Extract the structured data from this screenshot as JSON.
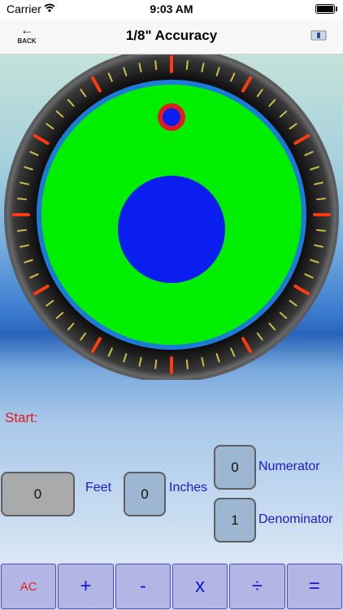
{
  "status_bar": {
    "carrier": "Carrier",
    "time": "9:03 AM"
  },
  "nav": {
    "back_label": "BACK",
    "back_arrow": "←",
    "title": "1/8\" Accuracy"
  },
  "start": {
    "label": "Start:"
  },
  "fields": {
    "feet": {
      "value": "0",
      "unit": "Feet"
    },
    "inches": {
      "value": "0",
      "unit": "Inches"
    },
    "numerator": {
      "value": "0",
      "unit": "Numerator"
    },
    "denominator": {
      "value": "1",
      "unit": "Denominator"
    }
  },
  "keypad": {
    "ac": "AC",
    "plus": "+",
    "minus": "-",
    "multiply": "x",
    "divide": "÷",
    "equals": "="
  },
  "colors": {
    "bezel": "#101010",
    "ring": "#1d7bd8",
    "face": "#00ee00",
    "bubble": "#0b1ef0",
    "indicator_ring": "#e21c1c",
    "tick_major": "#ff3a10",
    "tick_minor": "#c9c04a"
  },
  "icons": {
    "back": "left-arrow-icon",
    "right": "e-menu-icon",
    "wifi": "wifi-icon",
    "battery": "battery-icon"
  }
}
